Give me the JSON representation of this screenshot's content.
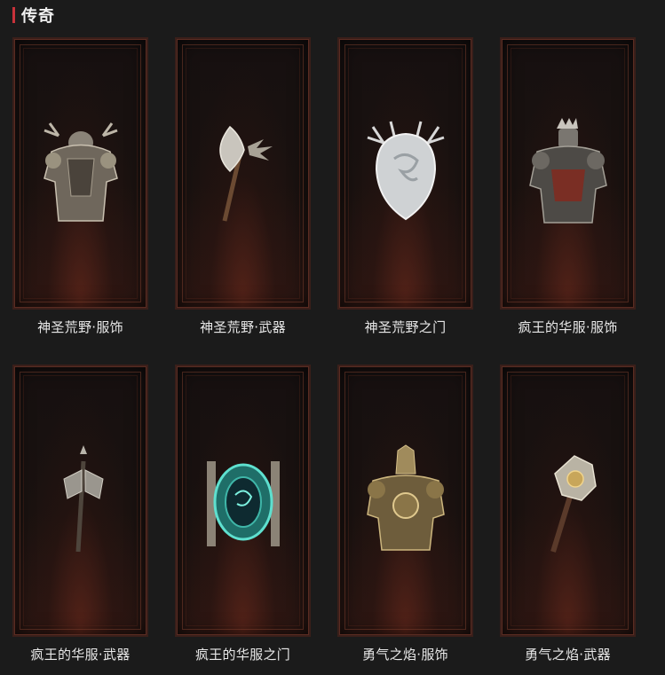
{
  "section": {
    "title": "传奇",
    "accent": "#c8323a"
  },
  "items": [
    {
      "label": "神圣荒野·服饰",
      "icon": "armor-antlers-icon"
    },
    {
      "label": "神圣荒野·武器",
      "icon": "axe-icon"
    },
    {
      "label": "神圣荒野之门",
      "icon": "portal-antler-mirror-icon"
    },
    {
      "label": "疯王的华服·服饰",
      "icon": "armor-crown-icon"
    },
    {
      "label": "疯王的华服·武器",
      "icon": "twin-blade-axe-icon"
    },
    {
      "label": "疯王的华服之门",
      "icon": "portal-teal-vortex-icon"
    },
    {
      "label": "勇气之焰·服饰",
      "icon": "armor-golden-icon"
    },
    {
      "label": "勇气之焰·武器",
      "icon": "golden-mace-icon"
    }
  ]
}
